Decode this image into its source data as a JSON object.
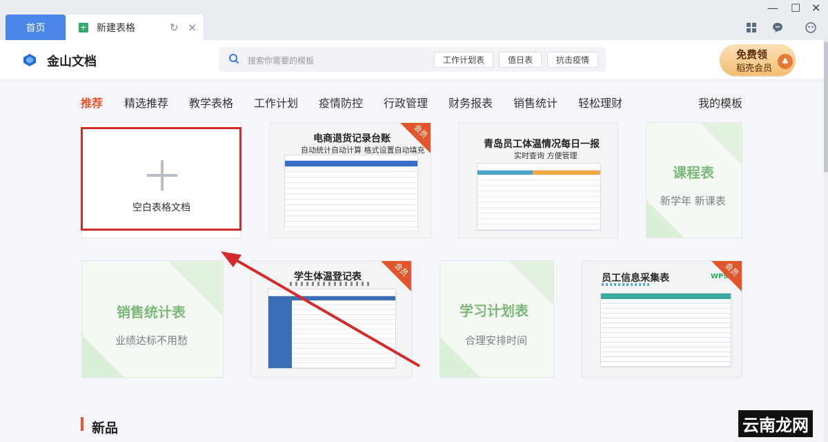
{
  "tabs": {
    "home_label": "首页",
    "active_label": "新建表格"
  },
  "window": {
    "minimize": "—",
    "maximize": "☐",
    "close": "✕"
  },
  "header": {
    "brand": "金山文档",
    "search_placeholder": "搜索你需要的模板",
    "search_chips": [
      "工作计划表",
      "值日表",
      "抗击疫情"
    ],
    "promo_line1": "免费领",
    "promo_line2": "稻壳会员"
  },
  "categories": {
    "items": [
      "推荐",
      "精选推荐",
      "教学表格",
      "工作计划",
      "疫情防控",
      "行政管理",
      "财务报表",
      "销售统计",
      "轻松理财"
    ],
    "active": "推荐",
    "my_templates": "我的模板"
  },
  "cards": {
    "blank": {
      "label": "空白表格文档"
    },
    "ecommerce": {
      "title": "电商退货记录台账",
      "subtitle": "自动统计自动计算 格式设置自动填充",
      "badge": "会员"
    },
    "temperature_daily": {
      "title": "青岛员工体温情况每日一报",
      "subtitle": "实时查询 方便管理"
    },
    "course": {
      "title": "课程表",
      "subtitle": "新学年 新课表"
    },
    "sales": {
      "title": "销售统计表",
      "subtitle": "业绩达标不用愁"
    },
    "student_temp": {
      "title": "学生体温登记表",
      "badge": "会员"
    },
    "study_plan": {
      "title": "学习计划表",
      "subtitle": "合理安排时间"
    },
    "employee_info": {
      "title": "员工信息采集表",
      "badge": "会员",
      "wps": "WPS"
    }
  },
  "section": {
    "title": "新品"
  },
  "watermark": {
    "text": "云南龙网"
  },
  "colors": {
    "accent": "#e8542c",
    "tab_blue": "#4a86e8",
    "card_green": "#7cb87a",
    "annotation_red": "#d42a2a"
  }
}
